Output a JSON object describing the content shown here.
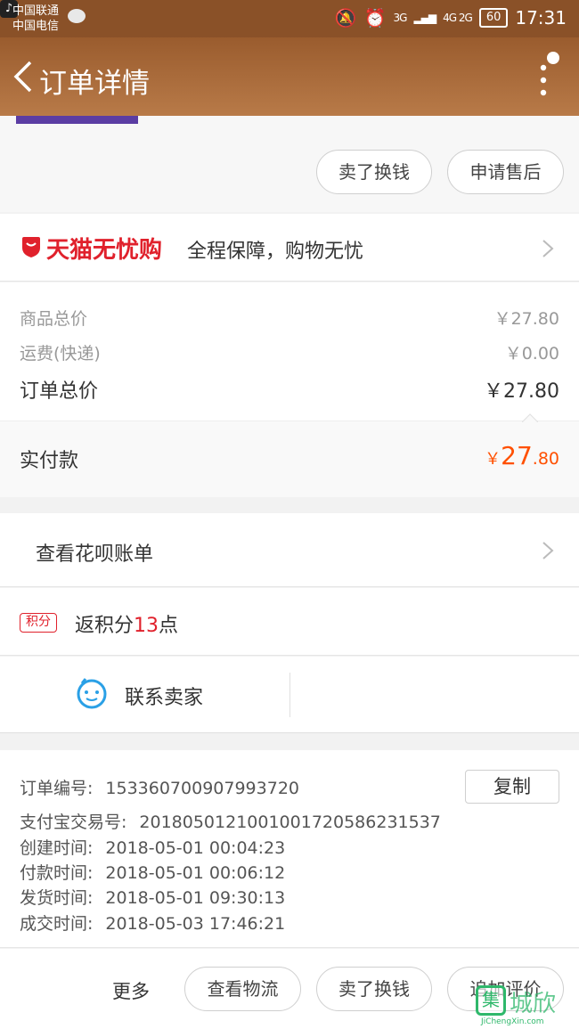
{
  "status_bar": {
    "carrier_1": "中国联通",
    "carrier_2": "中国电信",
    "network_1": "3G",
    "network_2": "4G 2G",
    "battery": "60",
    "time": "17:31",
    "icons": [
      "chat-icon",
      "tiktok-icon",
      "mute-icon",
      "alarm-icon",
      "signal-icon",
      "battery-icon"
    ]
  },
  "header": {
    "title": "订单详情",
    "icons": [
      "back-icon",
      "more-icon"
    ]
  },
  "actions_top": {
    "sell_exchange": "卖了换钱",
    "after_sale": "申请售后"
  },
  "guarantee": {
    "brand": "天猫无忧购",
    "slogan": "全程保障，购物无忧"
  },
  "prices": {
    "goods_total_label": "商品总价",
    "goods_total_value": "￥27.80",
    "shipping_label": "运费(快递)",
    "shipping_value": "￥0.00",
    "order_total_label": "订单总价",
    "order_total_value": "￥27.80"
  },
  "paid": {
    "label": "实付款",
    "currency": "￥",
    "integer": "27",
    "decimal": ".80"
  },
  "huabei": {
    "label": "查看花呗账单"
  },
  "points": {
    "badge": "积分",
    "prefix": "返积分",
    "amount": "13",
    "suffix": "点"
  },
  "contact": {
    "label": "联系卖家"
  },
  "order_info": {
    "order_no_label": "订单编号:",
    "order_no": "153360700907993720",
    "copy_label": "复制",
    "alipay_label": "支付宝交易号:",
    "alipay_no": "2018050121001001720586231537",
    "created_label": "创建时间:",
    "created": "2018-05-01 00:04:23",
    "paid_label": "付款时间:",
    "paid": "2018-05-01 00:06:12",
    "shipped_label": "发货时间:",
    "shipped": "2018-05-01 09:30:13",
    "completed_label": "成交时间:",
    "completed": "2018-05-03 17:46:21"
  },
  "bottom_bar": {
    "more": "更多",
    "logistics": "查看物流",
    "sell_exchange": "卖了换钱",
    "add_review": "追加评价"
  },
  "watermark": {
    "box": "集",
    "cn": "城欣",
    "en": "JiChengXin.com"
  },
  "colors": {
    "header_brown": "#9a5c2e",
    "tmall_red": "#e0212c",
    "paid_orange": "#ff5000",
    "cs_blue": "#2aa0e6"
  }
}
